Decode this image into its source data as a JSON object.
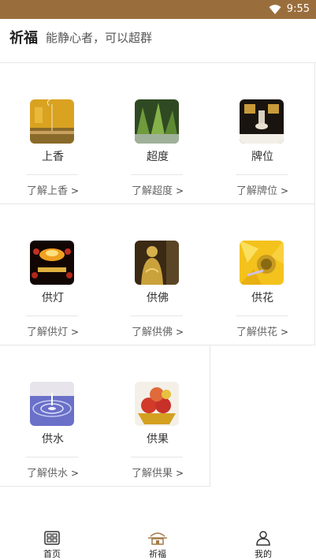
{
  "status": {
    "time": "9:55"
  },
  "header": {
    "title": "祈福",
    "subtitle": "能静心者，可以超群"
  },
  "items": [
    {
      "name": "上香",
      "more": "了解上香"
    },
    {
      "name": "超度",
      "more": "了解超度"
    },
    {
      "name": "牌位",
      "more": "了解牌位"
    },
    {
      "name": "供灯",
      "more": "了解供灯"
    },
    {
      "name": "供佛",
      "more": "了解供佛"
    },
    {
      "name": "供花",
      "more": "了解供花"
    },
    {
      "name": "供水",
      "more": "了解供水"
    },
    {
      "name": "供果",
      "more": "了解供果"
    }
  ],
  "tabs": [
    {
      "label": "首页",
      "icon": "home-grid-icon"
    },
    {
      "label": "祈福",
      "icon": "temple-icon",
      "active": true
    },
    {
      "label": "我的",
      "icon": "user-icon"
    }
  ],
  "colors": {
    "status_bar": "#9a6e3c",
    "accent": "#a37a48"
  }
}
